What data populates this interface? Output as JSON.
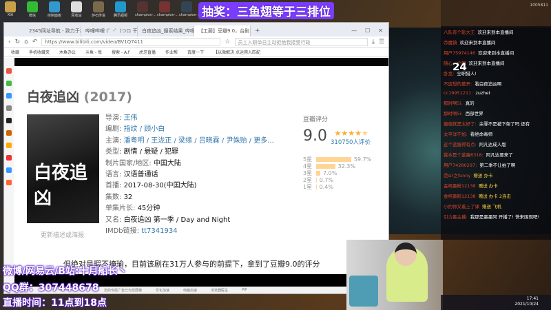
{
  "desktop": {
    "icons": [
      "XIA",
      "微信",
      "控制面板",
      "回收站",
      "炉石传说",
      "腾讯视频",
      "champion-...",
      "champion-...",
      "champion-..."
    ],
    "lottery": "抽奖：三鱼翅等于三排位"
  },
  "browser": {
    "tabs": [
      "2345网址导航 - 致力于打造百...",
      "哔哩哔哩 (゜-゜)つロ 干杯~",
      "白夜追凶_搜索结果_哔哩哔...",
      "【工藤】豆瓣9.0，台剧..."
    ],
    "url": "https://www.bilibili.com/video/BV1Q7411",
    "search_placeholder": "员工入职单日主动拒绝我接受行政",
    "bookmarks": [
      "收藏",
      "手机收藏夹",
      "木鱼办公",
      "斗鱼 - 每",
      "搜索 - A.f",
      "虎牙直播",
      "作业帮",
      "百度一下",
      "【以微解决 点运用入匹配"
    ],
    "status_items": [
      "您的专属广告已为您屏蔽",
      "优化加速",
      "电脑加速",
      "浏览器医生",
      "PiP"
    ]
  },
  "movie": {
    "title": "白夜追凶",
    "year": "(2017)",
    "poster_text": "白夜追凶",
    "update_link": "更新描述或海报",
    "info": [
      {
        "k": "导演:",
        "v": "王伟",
        "link": true
      },
      {
        "k": "编剧:",
        "v": "指纹 / 顾小白",
        "link": true
      },
      {
        "k": "主演:",
        "v": "潘粤明 / 王泷正 / 梁缘 / 吕晓霖 / 尹姝贻 / 更多...",
        "link": true
      },
      {
        "k": "类型:",
        "v": "剧情 / 悬疑 / 犯罪"
      },
      {
        "k": "制片国家/地区:",
        "v": "中国大陆"
      },
      {
        "k": "语言:",
        "v": "汉语普通话"
      },
      {
        "k": "首播:",
        "v": "2017-08-30(中国大陆)"
      },
      {
        "k": "集数:",
        "v": "32"
      },
      {
        "k": "单集片长:",
        "v": "45分钟"
      },
      {
        "k": "又名:",
        "v": "白夜追凶 第一季 / Day and Night"
      },
      {
        "k": "IMDb链接:",
        "v": "tt7341934",
        "link": true
      }
    ],
    "rating": {
      "label": "豆瓣评分",
      "score": "9.0",
      "stars": 4.5,
      "votes": "310750人评价",
      "dist": [
        {
          "s": "5星",
          "p": "59.7%",
          "v": 59.7
        },
        {
          "s": "4星",
          "p": "32.3%",
          "v": 32.3
        },
        {
          "s": "3星",
          "p": "7.0%",
          "v": 7.0
        },
        {
          "s": "2星",
          "p": "0.7%",
          "v": 0.7
        },
        {
          "s": "1星",
          "p": "0.4%",
          "v": 0.4
        }
      ]
    }
  },
  "subtitle": "但绝对是瑕不掩瑜，目前该剧在31万人参与的前提下，拿到了豆瓣9.0的评分",
  "overlay": {
    "line1": "微博/网易云/B站:十月船长丶",
    "line2": "QQ群：307448678",
    "line3": "直播时间：11点到18点"
  },
  "chat": {
    "heat": "1005811",
    "countdown": "24",
    "messages": [
      {
        "u": "八队有个影大王",
        "t": "欢迎来到本直播间"
      },
      {
        "u": "帝魔镇",
        "t": "欢迎来到本直播间"
      },
      {
        "u": "用户759741​46",
        "t": "欢迎来到本直播间"
      },
      {
        "u": "随心一个呢",
        "t": "欢迎来到本直播间"
      },
      {
        "u": "卧龙:",
        "t": "全职猎人!"
      },
      {
        "u": "不这想的葛开:",
        "t": "看白夜追凶啊"
      },
      {
        "u": "cc19951211:",
        "t": "zuzhet"
      },
      {
        "u": "那时啊5i:",
        "t": "真的"
      },
      {
        "u": "那时啊5i:",
        "t": "西部世界"
      },
      {
        "u": "偏偏就是太好了:",
        "t": "余罪不是被下架了吗 还有"
      },
      {
        "u": "太平洋不加:",
        "t": "看绝命毒师"
      },
      {
        "u": "这个蓝瘦得有点:",
        "t": "阿凡达成人版"
      },
      {
        "u": "我本是个蓝瘦6318:",
        "t": "阿凡达要来了"
      },
      {
        "u": "用户74280297:",
        "t": "第二季不让拍了啊"
      },
      {
        "u": "范sir之funny",
        "g": "赠送 办卡"
      },
      {
        "u": "金柯墨粉12138",
        "g": "赠送 办卡"
      },
      {
        "u": "金柯墨粉12138",
        "g": "赠送 办卡 2连击"
      },
      {
        "u": "小约你又着上了课",
        "g": "赠送 飞机"
      },
      {
        "u": "引力墨主播:",
        "t": "我那是墨墨阿 开播了! 快来围观吧!"
      }
    ]
  },
  "tray": {
    "time": "17:41",
    "date": "2021/10/24"
  }
}
